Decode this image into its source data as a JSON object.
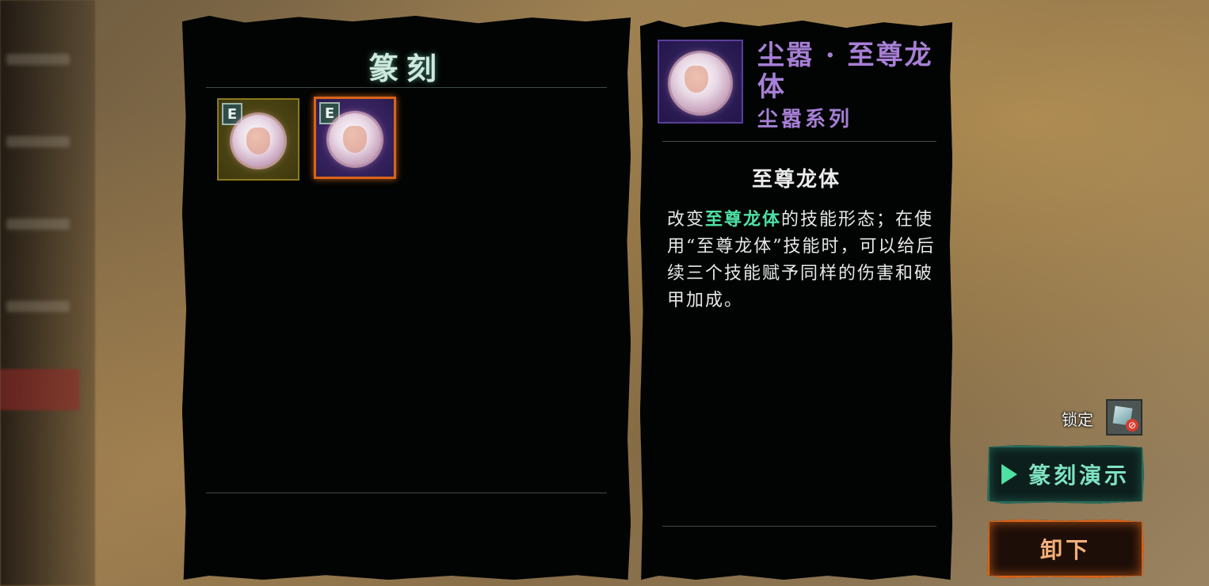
{
  "engraving_panel": {
    "title": "篆刻",
    "slots": [
      {
        "badge": "E",
        "frame": "gold",
        "icon": "dust-orb-icon",
        "selected": false
      },
      {
        "badge": "E",
        "frame": "purple",
        "icon": "dust-orb-icon",
        "selected": true
      }
    ]
  },
  "detail": {
    "name": "尘嚣 · 至尊龙体",
    "series": "尘嚣系列",
    "effect_title": "至尊龙体",
    "desc_prefix": "改变",
    "desc_highlight": "至尊龙体",
    "desc_rest": "的技能形态；在使用“至尊龙体”技能时，可以给后续三个技能赋予同样的伤害和破甲加成。",
    "name_color": "#a77fd6",
    "highlight_color": "#4fe0a4"
  },
  "lock": {
    "label": "锁定",
    "icon": "lock-cube-icon"
  },
  "buttons": {
    "demo": "篆刻演示",
    "unequip": "卸下"
  }
}
